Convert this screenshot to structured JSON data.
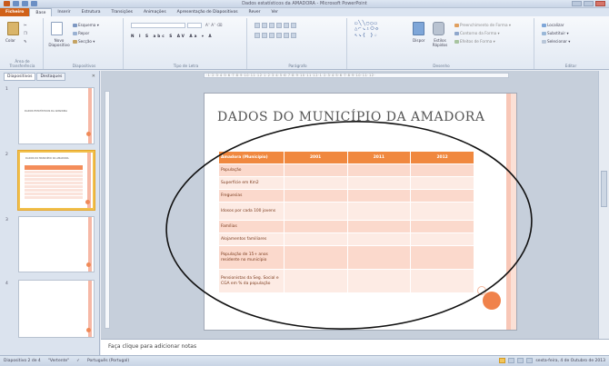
{
  "window": {
    "title": "Dados estatísticos da AMADORA - Microsoft PowerPoint"
  },
  "tabs": [
    {
      "label": "Ficheiro"
    },
    {
      "label": "Base"
    },
    {
      "label": "Inserir"
    },
    {
      "label": "Estrutura"
    },
    {
      "label": "Transições"
    },
    {
      "label": "Animações"
    },
    {
      "label": "Apresentação de Diapositivos"
    },
    {
      "label": "Rever"
    },
    {
      "label": "Ver"
    }
  ],
  "ribbon": {
    "clipboard": {
      "label": "Área de Transferência",
      "paste": "Colar"
    },
    "slides": {
      "label": "Diapositivos",
      "new_slide": "Novo Diapositivo",
      "layout": "Esquema",
      "reset": "Repor",
      "section": "Secção"
    },
    "font": {
      "label": "Tipo de Letra"
    },
    "paragraph": {
      "label": "Parágrafo"
    },
    "drawing": {
      "label": "Desenho",
      "arrange": "Dispor",
      "quick_styles": "Estilos Rápidos",
      "shape_fill": "Preenchimento de Forma",
      "shape_outline": "Contorno da Forma",
      "shape_effects": "Efeitos de Forma"
    },
    "editing": {
      "label": "Editar",
      "find": "Localizar",
      "replace": "Substituir",
      "select": "Selecionar"
    }
  },
  "panel": {
    "tabs": [
      {
        "label": "Diapositivos"
      },
      {
        "label": "Destaques"
      }
    ],
    "thumbs": [
      {
        "number": "1",
        "title": "DADOS ESTATÍSTICOS DA AMADORA"
      },
      {
        "number": "2",
        "title": "DADOS DO MUNICÍPIO DA AMADORA"
      },
      {
        "number": "3"
      },
      {
        "number": "4"
      }
    ]
  },
  "slide": {
    "title": "DADOS DO MUNICÍPIO DA AMADORA",
    "table": {
      "headers": [
        "Amadora (Município)",
        "2001",
        "2011",
        "2012"
      ],
      "rows": [
        [
          "População",
          "",
          "",
          ""
        ],
        [
          "Superfície em Km2",
          "",
          "",
          ""
        ],
        [
          "Freguesias",
          "",
          "",
          ""
        ],
        [
          "Idosos por cada 100 jovens",
          "",
          "",
          ""
        ],
        [
          "Famílias",
          "",
          "",
          ""
        ],
        [
          "Alojamentos familiares",
          "",
          "",
          ""
        ],
        [
          "População de 15+ anos residente no município",
          "",
          "",
          ""
        ],
        [
          "Pensionistas da Seg. Social e CGA em % da população",
          "",
          "",
          ""
        ]
      ]
    }
  },
  "notes": {
    "placeholder": "Faça clique para adicionar notas"
  },
  "status": {
    "slide_info": "Diapositivo 2 de 4",
    "theme": "\"Vertente\"",
    "language": "Português (Portugal)",
    "date": "sexta-feira, 4 de Outubro de 2013"
  },
  "colors": {
    "accent": "#f0883f",
    "file_tab": "#d0611a",
    "row_a": "#fbd9cc",
    "row_b": "#fdebe4"
  }
}
